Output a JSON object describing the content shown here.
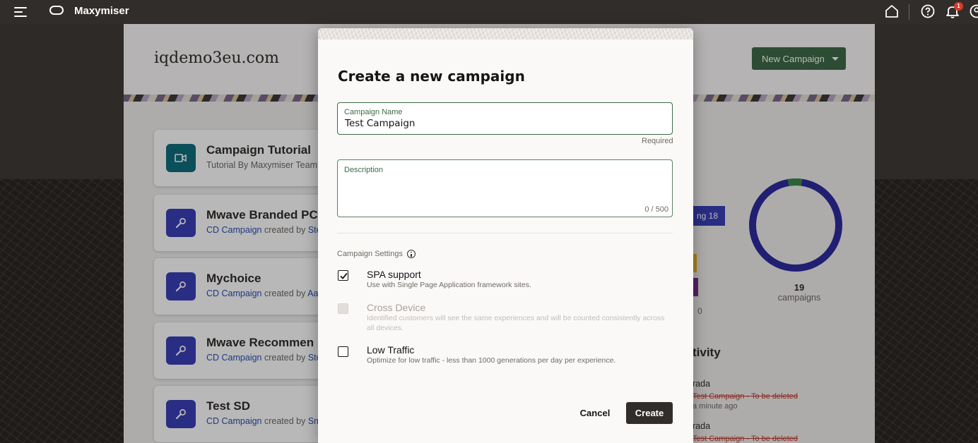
{
  "app": {
    "name": "Maxymiser",
    "notification_count": "1"
  },
  "page": {
    "site_title": "iqdemo3eu.com",
    "new_campaign_label": "New Campaign"
  },
  "cards": [
    {
      "title": "Campaign Tutorial",
      "sub_plain": "Tutorial By Maxymiser Team",
      "icon": "video-camera-icon",
      "color": "#0f6e7c"
    },
    {
      "title": "Mwave Branded PC",
      "link": "CD Campaign",
      "created": " created by ",
      "author": "Ste",
      "icon": "wrench-icon",
      "color": "#3a3fb8"
    },
    {
      "title": "Mychoice",
      "link": "CD Campaign",
      "created": " created by ",
      "author": "Aa",
      "icon": "wrench-icon",
      "color": "#3a3fb8"
    },
    {
      "title": "Mwave Recommen",
      "link": "CD Campaign",
      "created": " created by ",
      "author": "Ste",
      "icon": "wrench-icon",
      "color": "#3a3fb8"
    },
    {
      "title": "Test SD",
      "link": "CD Campaign",
      "created": " created by ",
      "author": "Sm",
      "icon": "wrench-icon",
      "color": "#3a3fb8"
    }
  ],
  "stats": {
    "pill_text": "ng  18",
    "zero": "0",
    "total_count": "19",
    "total_label": "campaigns",
    "donut_fraction_green": 0.05,
    "colors": {
      "donut_main": "#2e2c9e",
      "donut_accent": "#3e8a4a"
    }
  },
  "activity": {
    "title": "tivity",
    "items": [
      {
        "name": "rada",
        "struck": "Test Campaign - To be deleted",
        "time": "a minute ago"
      },
      {
        "name": "rada",
        "struck": "Test Campaign - To be deleted"
      }
    ]
  },
  "modal": {
    "title": "Create a new campaign",
    "campaign_name": {
      "label": "Campaign Name",
      "value": "Test Campaign",
      "hint": "Required"
    },
    "description": {
      "label": "Description",
      "value": "",
      "counter": "0 / 500"
    },
    "settings_label": "Campaign Settings",
    "options": [
      {
        "title": "SPA support",
        "desc": "Use with Single Page Application framework sites.",
        "checked": true,
        "disabled": false
      },
      {
        "title": "Cross Device",
        "desc": "Identified customers will see the same experiences and will be counted consistently across all devices.",
        "checked": false,
        "disabled": true
      },
      {
        "title": "Low Traffic",
        "desc": "Optimize for low traffic - less than 1000 generations per day per experience.",
        "checked": false,
        "disabled": false
      }
    ],
    "cancel_label": "Cancel",
    "create_label": "Create"
  }
}
